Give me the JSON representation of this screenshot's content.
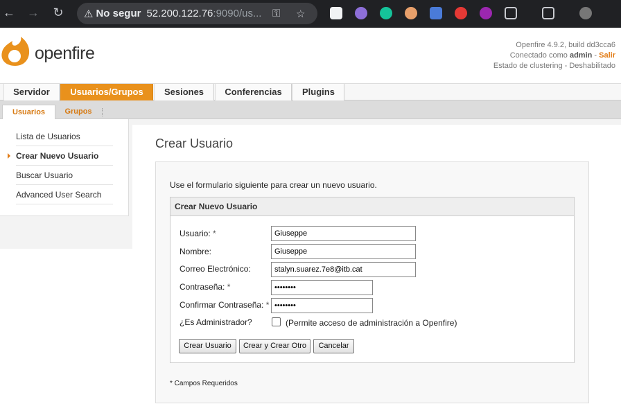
{
  "browser": {
    "security_label": "No segur",
    "url_host": "52.200.122.76",
    "url_rest": ":9090/us..."
  },
  "header": {
    "logo_text": "openfire",
    "version_line": "Openfire 4.9.2, build dd3cca6",
    "connected_prefix": "Conectado como",
    "user": "admin",
    "logout": "Salir",
    "cluster_status": "Estado de clustering - Deshabilitado"
  },
  "tabs": [
    "Servidor",
    "Usuarios/Grupos",
    "Sesiones",
    "Conferencias",
    "Plugins"
  ],
  "subtabs": [
    "Usuarios",
    "Grupos"
  ],
  "sidebar": {
    "items": [
      "Lista de Usuarios",
      "Crear Nuevo Usuario",
      "Buscar Usuario",
      "Advanced User Search"
    ]
  },
  "main": {
    "title": "Crear Usuario",
    "intro": "Use el formulario siguiente para crear un nuevo usuario.",
    "box_title": "Crear Nuevo Usuario",
    "fields": {
      "username_label": "Usuario:",
      "username_value": "Giuseppe",
      "name_label": "Nombre:",
      "name_value": "Giuseppe",
      "email_label": "Correo Electrónico:",
      "email_value": "stalyn.suarez.7e8@itb.cat",
      "password_label": "Contraseña:",
      "password_value": "••••••••",
      "confirm_label": "Confirmar Contraseña:",
      "confirm_value": "••••••••",
      "admin_label": "¿Es Administrador?",
      "admin_note": "(Permite acceso de administración a Openfire)",
      "required_mark": "*"
    },
    "buttons": {
      "create": "Crear Usuario",
      "create_another": "Crear y Crear Otro",
      "cancel": "Cancelar"
    },
    "footnote": "* Campos Requeridos"
  },
  "colors": {
    "accent": "#e9911c",
    "link": "#d77a12"
  }
}
